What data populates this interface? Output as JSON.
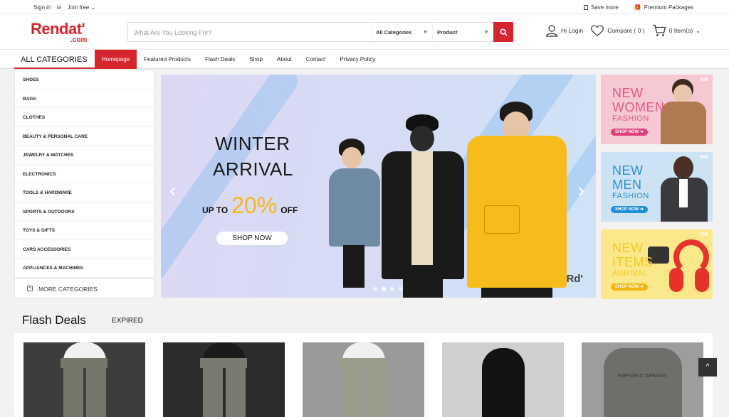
{
  "topbar": {
    "sign_in": "Sign in",
    "or": "or",
    "join_free": "Join free",
    "save_more": "Save more",
    "premium_packages": "Premium Packages"
  },
  "header": {
    "logo_main": "Rendat'",
    "logo_sub": ".com",
    "search_placeholder": "What Are You Looking For?",
    "category_select": "All Categories",
    "type_select": "Product",
    "hi_login": "Hi Login",
    "compare": "Compare ( 0 )",
    "cart": "0 Item(s)"
  },
  "nav": {
    "all_categories": "ALL CATEGORIES",
    "links": [
      {
        "label": "Homepage",
        "active": true
      },
      {
        "label": "Featured Products"
      },
      {
        "label": "Flash Deals"
      },
      {
        "label": "Shop"
      },
      {
        "label": "About"
      },
      {
        "label": "Contact"
      },
      {
        "label": "Privacy Policy"
      }
    ]
  },
  "sidebar": {
    "categories": [
      "SHOES",
      "BAGS",
      "CLOTHES",
      "BEAUTY & PERSONAL CARE",
      "JEWELRY & WATCHES",
      "ELECTRONICS",
      "TOOLS & HARDWARE",
      "SPORTS & OUTDOORS",
      "TOYS & GIFTS",
      "CARS ACCESSORIES",
      "APPLIANCES & MACHINES"
    ],
    "more": "MORE CATEGORIES"
  },
  "hero": {
    "line1": "WINTER",
    "line2": "ARRIVAL",
    "up_to": "UP TO",
    "percent": "20%",
    "off": "OFF",
    "button": "SHOP NOW",
    "watermark": "Rd'",
    "slide_count": 4,
    "active_slide": 1
  },
  "banners": [
    {
      "l1": "NEW",
      "l2": "WOMEN",
      "l3": "FASHION",
      "button": "SHOP NOW ➜",
      "bg": "#f6c8d2",
      "accent": "#e05a7f",
      "button_color": "#e0407a",
      "wm": "Rd'"
    },
    {
      "l1": "NEW",
      "l2": "MEN",
      "l3": "FASHION",
      "button": "SHOP NOW ➜",
      "bg": "#cde3f3",
      "accent": "#2a8fd0",
      "button_color": "#1f8fd8",
      "wm": "Rd'"
    },
    {
      "l1": "NEW",
      "l2": "ITEMS",
      "l3": "ARRIVAL",
      "button": "SHOP NOW ➜",
      "bg": "#fbe88a",
      "accent": "#f4c724",
      "button_color": "#f1b514",
      "wm": "Rd'"
    }
  ],
  "flash": {
    "title": "Flash Deals",
    "status": "EXPIRED",
    "products": [
      {
        "bg": "#3d3d3d",
        "top": "#f1f1f1",
        "pants": "#74786a",
        "print": ""
      },
      {
        "bg": "#2c2c2c",
        "top": "#1b1b1b",
        "pants": "#7a7a70",
        "print": ""
      },
      {
        "bg": "#9a9a9a",
        "top": "#f0f0f0",
        "pants": "#9c9c8a",
        "print": ""
      },
      {
        "bg": "#cfcfcf",
        "top": "#121212",
        "pants": "#121212",
        "print": ""
      },
      {
        "bg": "#9d9d9d",
        "top": "#6d6f6a",
        "pants": "#6d6f6a",
        "print": "EMPORIO ARMANI"
      }
    ]
  },
  "back_to_top": "^",
  "colors": {
    "brand": "#d5262d",
    "hero_offer": "#f8b61b"
  }
}
